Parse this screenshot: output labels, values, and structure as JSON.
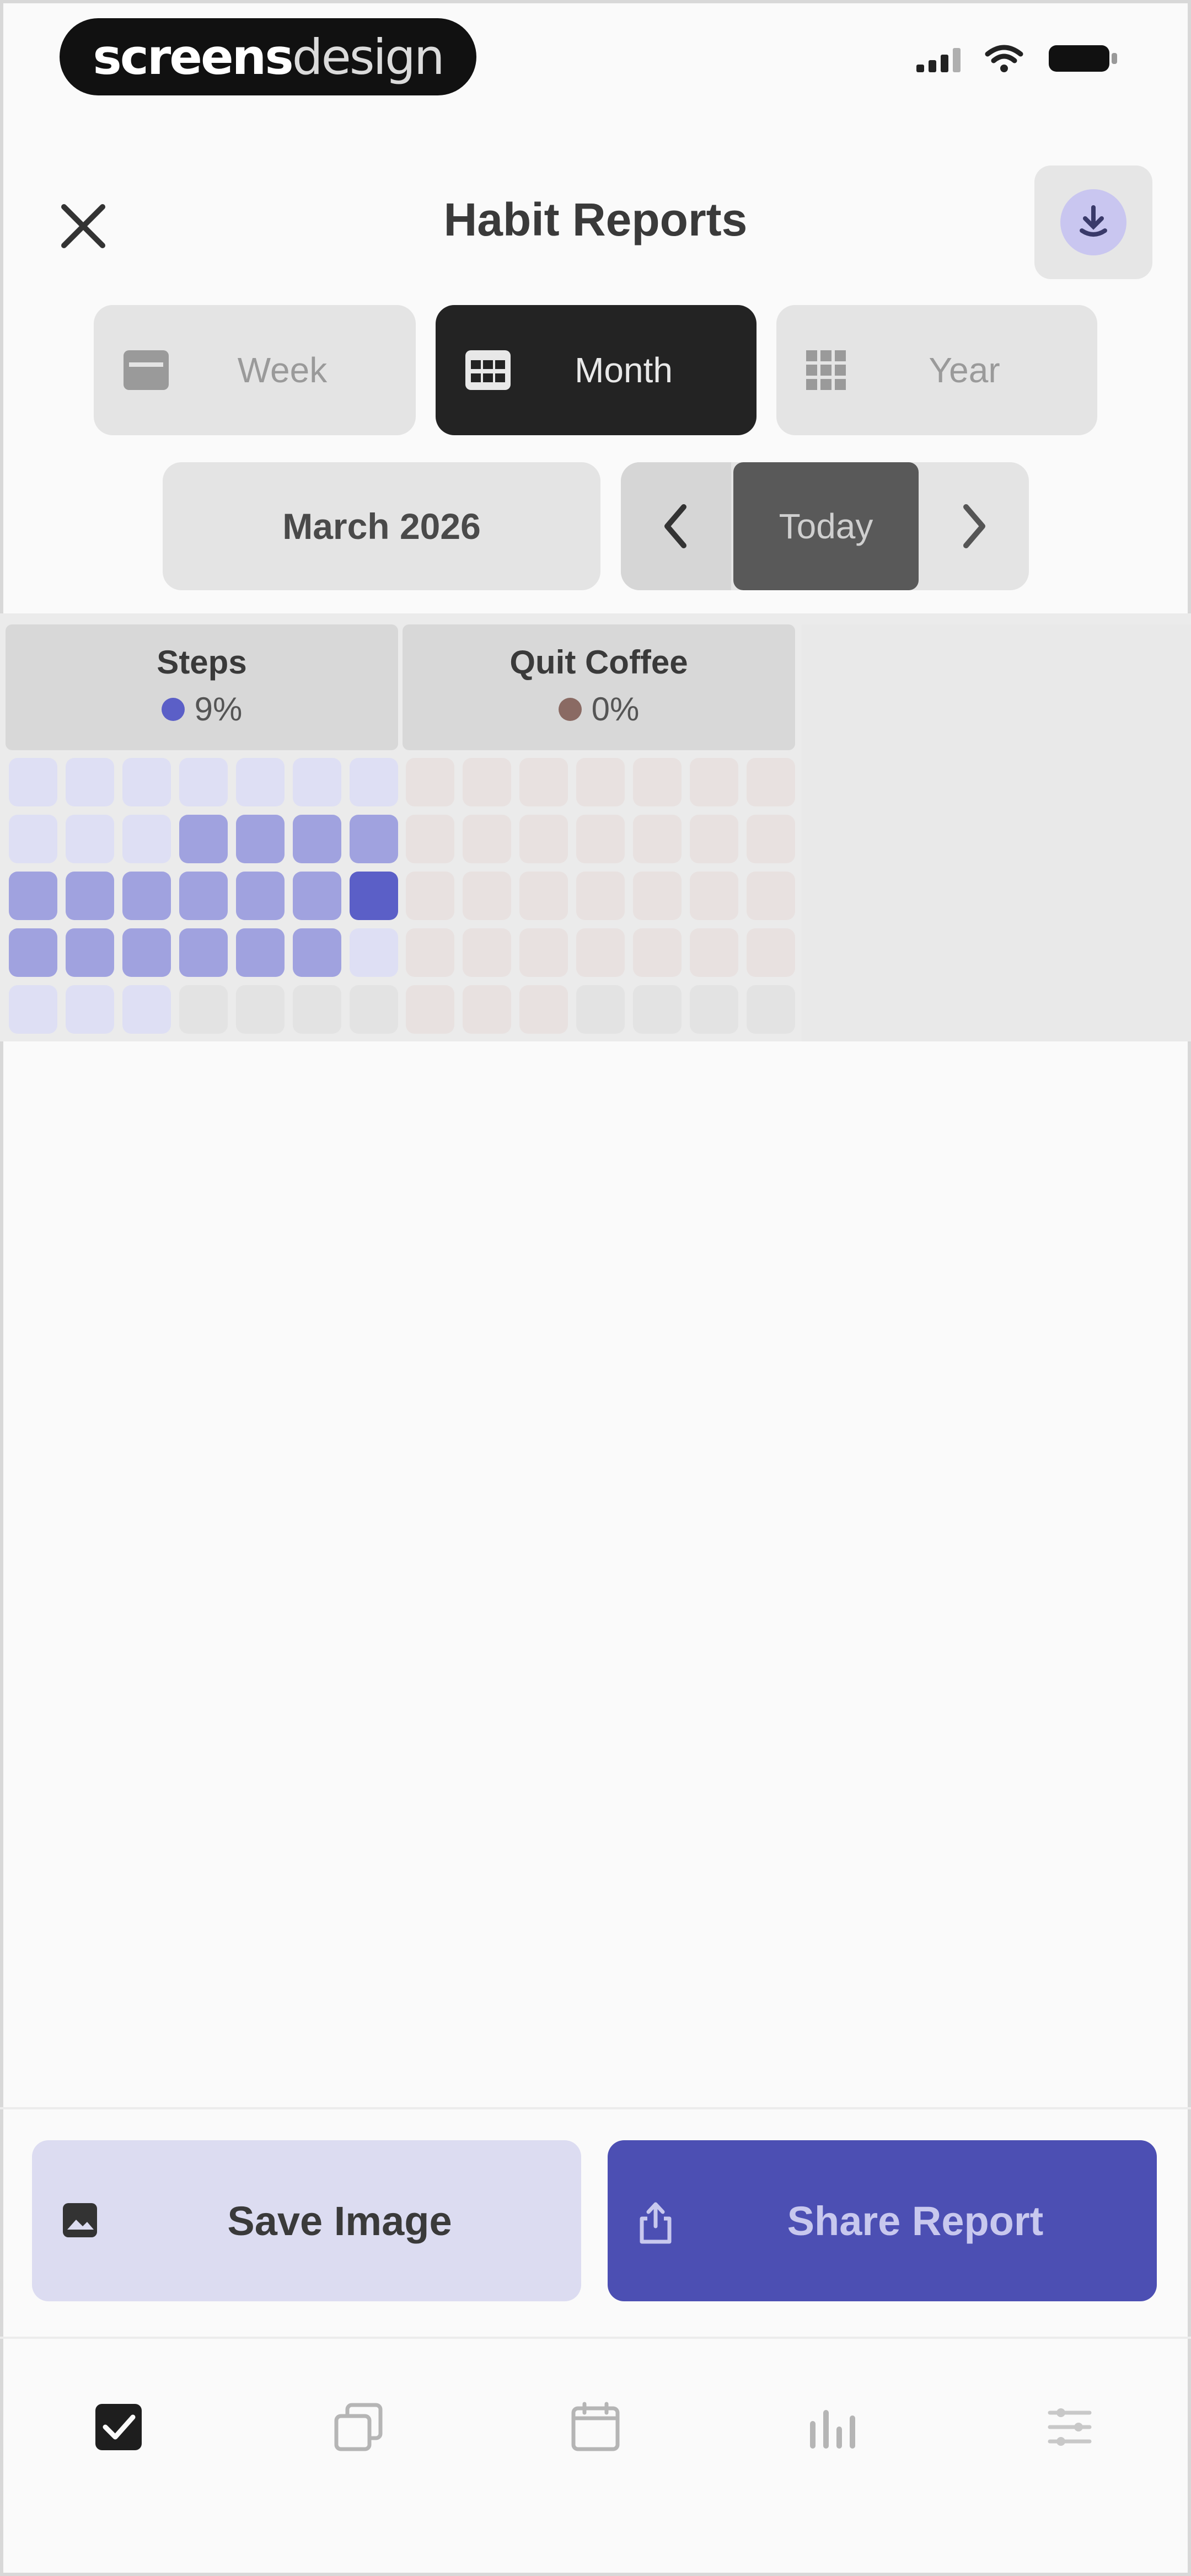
{
  "status_bar": {
    "brand_bold": "screens",
    "brand_light": "design"
  },
  "header": {
    "title": "Habit Reports"
  },
  "view_tabs": [
    {
      "label": "Week",
      "icon": "calendar-week-icon",
      "active": false
    },
    {
      "label": "Month",
      "icon": "calendar-month-icon",
      "active": true
    },
    {
      "label": "Year",
      "icon": "calendar-year-icon",
      "active": false
    }
  ],
  "period": {
    "label": "March 2026",
    "today_label": "Today"
  },
  "habits": [
    {
      "name": "Steps",
      "percent": "9%",
      "color": "#5b5fc7",
      "cells": [
        1,
        1,
        1,
        1,
        1,
        1,
        1,
        1,
        1,
        1,
        2,
        2,
        2,
        2,
        2,
        2,
        2,
        2,
        2,
        2,
        3,
        2,
        2,
        2,
        2,
        2,
        2,
        1,
        1,
        1,
        1,
        0,
        0,
        0,
        0
      ]
    },
    {
      "name": "Quit Coffee",
      "percent": "0%",
      "color": "#8a6a63",
      "cells": [
        1,
        1,
        1,
        1,
        1,
        1,
        1,
        1,
        1,
        1,
        1,
        1,
        1,
        1,
        1,
        1,
        1,
        1,
        1,
        1,
        1,
        1,
        1,
        1,
        1,
        1,
        1,
        1,
        1,
        1,
        1,
        0,
        0,
        0,
        0
      ]
    }
  ],
  "actions": {
    "save_label": "Save Image",
    "share_label": "Share Report"
  },
  "tab_bar": [
    {
      "icon": "checkbox-icon",
      "active": true
    },
    {
      "icon": "copy-icon",
      "active": false
    },
    {
      "icon": "calendar-icon",
      "active": false
    },
    {
      "icon": "stats-icon",
      "active": false
    },
    {
      "icon": "settings-list-icon",
      "active": false
    }
  ],
  "colors": {
    "accent": "#4c4fb3",
    "active_tab": "#232323"
  }
}
